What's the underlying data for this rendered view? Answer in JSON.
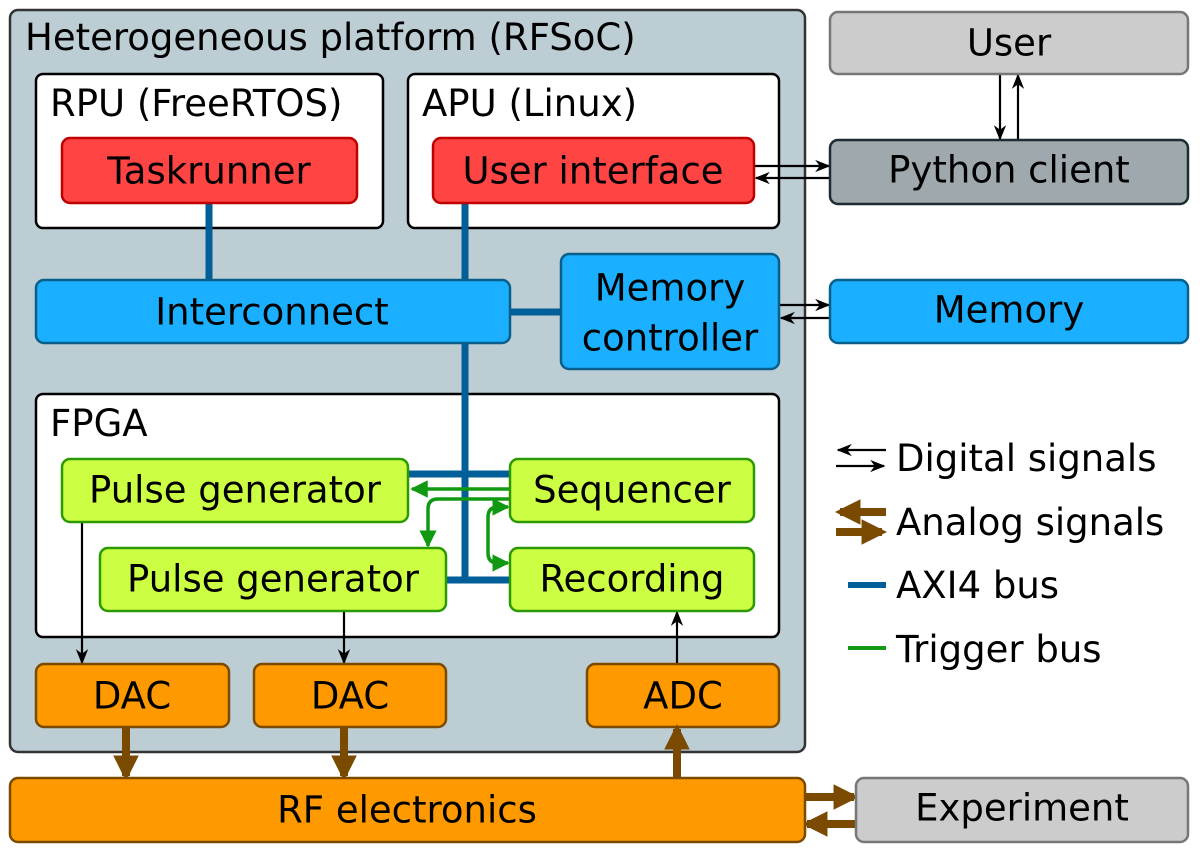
{
  "platform": {
    "title": "Heterogeneous platform (RFSoC)"
  },
  "rpu": {
    "title": "RPU (FreeRTOS)",
    "taskrunner": "Taskrunner"
  },
  "apu": {
    "title": "APU (Linux)",
    "user_interface": "User interface"
  },
  "interconnect": "Interconnect",
  "memory_controller": {
    "line1": "Memory",
    "line2": "controller"
  },
  "fpga": {
    "title": "FPGA",
    "pulse_generator_1": "Pulse generator",
    "pulse_generator_2": "Pulse generator",
    "sequencer": "Sequencer",
    "recording": "Recording"
  },
  "converters": {
    "dac_1": "DAC",
    "dac_2": "DAC",
    "adc": "ADC"
  },
  "external": {
    "user": "User",
    "python_client": "Python client",
    "memory": "Memory",
    "rf_electronics": "RF electronics",
    "experiment": "Experiment"
  },
  "legend": {
    "digital": "Digital signals",
    "analog": "Analog signals",
    "axi4": "AXI4 bus",
    "trigger": "Trigger bus"
  },
  "colors": {
    "platform": "#bccdd4",
    "cpu_block": "#ff4444",
    "bus_block": "#1ab0ff",
    "fpga_block": "#ccff44",
    "converter": "#ff9900",
    "external_grey": "#cccccc",
    "python_client": "#9ea8ad",
    "axi4_bus": "#005f99",
    "trigger_bus": "#119911",
    "analog": "#7a4a00"
  }
}
